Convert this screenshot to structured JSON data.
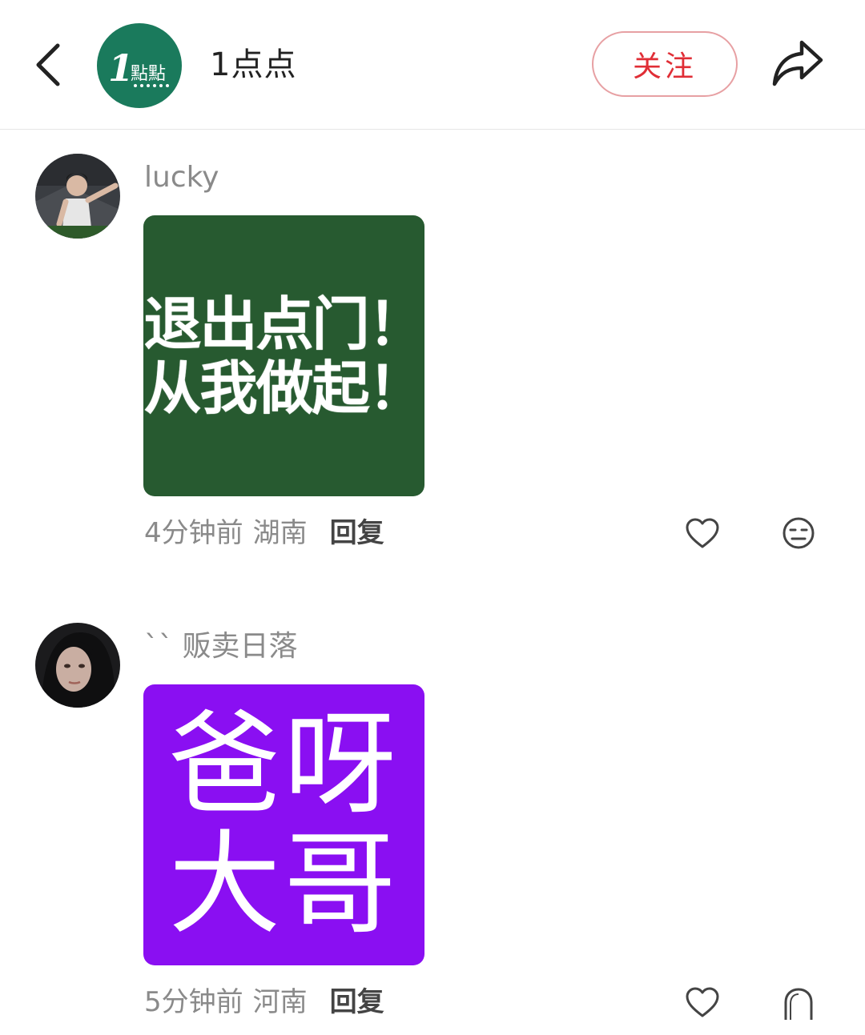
{
  "header": {
    "account_name": "1点点",
    "logo_text_main": "1",
    "logo_text_sub": "點點",
    "follow_label": "关注"
  },
  "comments": [
    {
      "username": "lucky",
      "sticker_lines": [
        "退出点门！",
        "从我做起！"
      ],
      "sticker_color": "#275a30",
      "time": "4分钟前",
      "region": "湖南",
      "reply_label": "回复"
    },
    {
      "username": "`` 贩卖日落",
      "sticker_lines": [
        "爸呀",
        "大哥"
      ],
      "sticker_color": "#8a0ff2",
      "time": "5分钟前",
      "region": "河南",
      "reply_label": "回复"
    }
  ],
  "colors": {
    "accent": "#e02e36",
    "logo_bg": "#1a7a5c",
    "muted_text": "#8a8a8a"
  },
  "icons": [
    "back-icon",
    "share-icon",
    "heart-icon",
    "emoji-neutral-icon",
    "emoji-arc-icon"
  ]
}
